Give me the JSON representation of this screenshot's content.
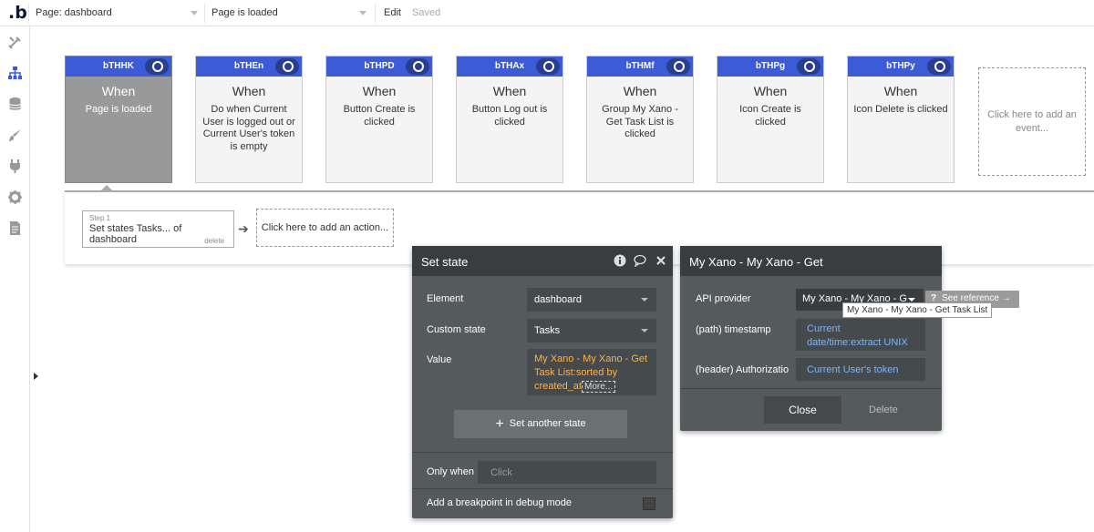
{
  "topbar": {
    "logo": ".b",
    "page_select": "Page: dashboard",
    "event_select": "Page is loaded",
    "edit": "Edit",
    "saved": "Saved"
  },
  "sidebar": {
    "icons": [
      "design-icon",
      "workflow-icon",
      "data-icon",
      "styles-icon",
      "plugins-icon",
      "settings-icon",
      "logs-icon"
    ]
  },
  "events": [
    {
      "id": "bTHHK",
      "when": "When",
      "desc": "Page is loaded"
    },
    {
      "id": "bTHEn",
      "when": "When",
      "desc": "Do when Current User is logged out or Current User's token is empty"
    },
    {
      "id": "bTHPD",
      "when": "When",
      "desc": "Button Create is clicked"
    },
    {
      "id": "bTHAx",
      "when": "When",
      "desc": "Button Log out is clicked"
    },
    {
      "id": "bTHMf",
      "when": "When",
      "desc": "Group My Xano - Get Task List is clicked"
    },
    {
      "id": "bTHPg",
      "when": "When",
      "desc": "Icon Create is clicked"
    },
    {
      "id": "bTHPy",
      "when": "When",
      "desc": "Icon Delete is clicked"
    }
  ],
  "add_event": "Click here to add an event...",
  "actions": {
    "step_num": "Step 1",
    "step_title": "Set states Tasks... of dashboard",
    "step_delete": "delete",
    "add_action": "Click here to add an action..."
  },
  "set_state": {
    "title": "Set state",
    "element_label": "Element",
    "element_value": "dashboard",
    "custom_state_label": "Custom state",
    "custom_state_value": "Tasks",
    "value_label": "Value",
    "value_expr": "My Xano - My Xano - Get Task List:sorted by created_at",
    "more": "More...",
    "set_another": "Set another state",
    "only_when_label": "Only when",
    "only_when_placeholder": "Click",
    "breakpoint_label": "Add a breakpoint in debug mode"
  },
  "api_panel": {
    "title": "My Xano - My Xano - Get",
    "provider_label": "API provider",
    "provider_value": "My Xano - My Xano - G",
    "timestamp_label": "(path) timestamp",
    "timestamp_value": "Current date/time:extract UNIX",
    "auth_label": "(header) Authorizatio",
    "auth_value": "Current User's token",
    "close": "Close",
    "delete": "Delete",
    "see_reference": "See reference →",
    "see_reference_q": "?",
    "tooltip": "My Xano - My Xano - Get Task List"
  },
  "colors": {
    "event_header": "#3c5bd6",
    "panel_bg": "#555a5d",
    "expression": "#ffb14a",
    "dynamic_value": "#7cb4ff"
  }
}
